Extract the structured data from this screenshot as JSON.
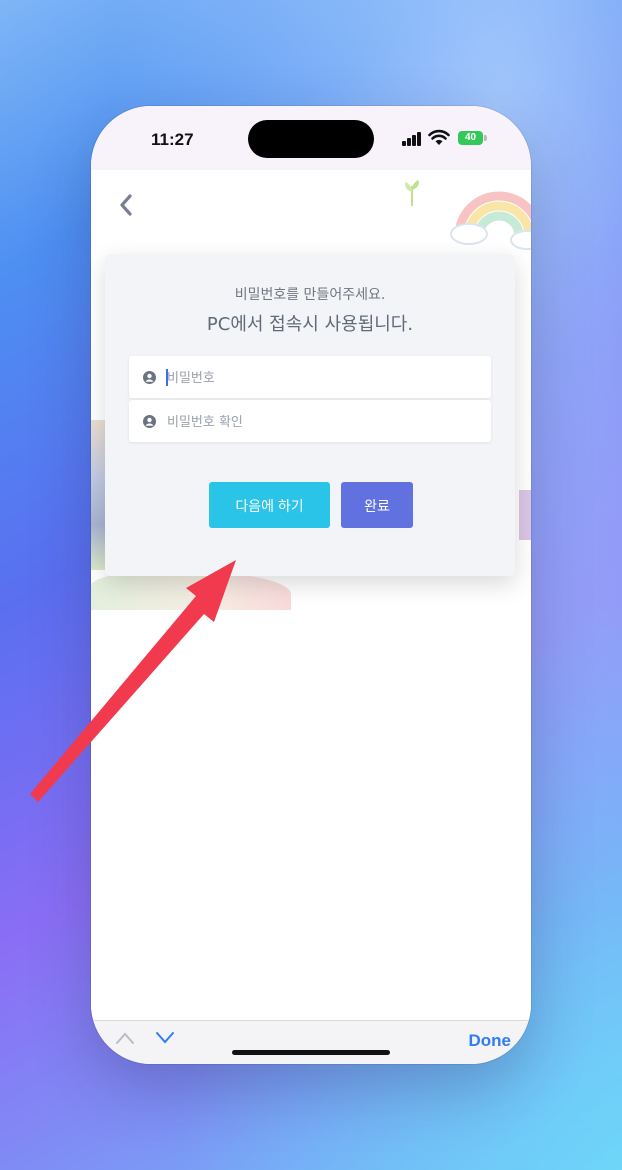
{
  "status_bar": {
    "time": "11:27",
    "battery": "40"
  },
  "page": {
    "back_icon": "chevron-left-icon",
    "accent_color": "#29c4e8",
    "primary_color": "#6271e0"
  },
  "modal": {
    "subtitle": "비밀번호를 만들어주세요.",
    "title": "PC에서 접속시 사용됩니다.",
    "password_placeholder": "비밀번호",
    "password_value": "",
    "confirm_placeholder": "비밀번호 확인",
    "confirm_value": "",
    "field_icon": "user-icon",
    "later_button": "다음에 하기",
    "done_button": "완료"
  },
  "keyboard_toolbar": {
    "done_label": "Done"
  },
  "annotation": {
    "arrow_color": "#f23a4f"
  }
}
